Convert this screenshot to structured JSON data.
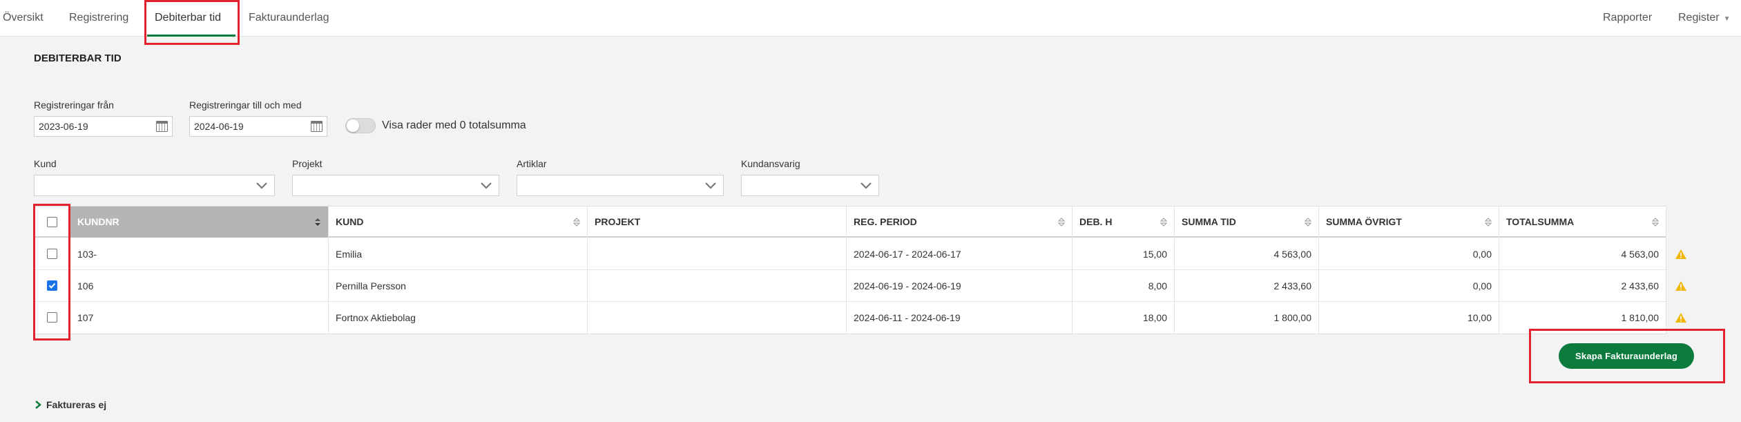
{
  "nav": {
    "tabs": [
      "Översikt",
      "Registrering",
      "Debiterbar tid",
      "Fakturaunderlag"
    ],
    "right": [
      "Rapporter",
      "Register"
    ]
  },
  "page_title": "DEBITERBAR TID",
  "filters": {
    "from_label": "Registreringar från",
    "from_value": "2023-06-19",
    "to_label": "Registreringar till och med",
    "to_value": "2024-06-19",
    "toggle_label": "Visa rader med 0 totalsumma",
    "toggle_on": false,
    "kund_label": "Kund",
    "projekt_label": "Projekt",
    "artiklar_label": "Artiklar",
    "kundansvarig_label": "Kundansvarig"
  },
  "table": {
    "columns": [
      "KUNDNR",
      "KUND",
      "PROJEKT",
      "REG. PERIOD",
      "DEB. H",
      "SUMMA TID",
      "SUMMA ÖVRIGT",
      "TOTALSUMMA"
    ],
    "rows": [
      {
        "kundnr": "103-",
        "kund": "Emilia",
        "projekt": "",
        "period": "2024-06-17 - 2024-06-17",
        "deb_h": "15,00",
        "summa_tid": "4 563,00",
        "summa_ovrigt": "0,00",
        "totalsumma": "4 563,00",
        "checked": false
      },
      {
        "kundnr": "106",
        "kund": "Pernilla Persson",
        "projekt": "",
        "period": "2024-06-19 - 2024-06-19",
        "deb_h": "8,00",
        "summa_tid": "2 433,60",
        "summa_ovrigt": "0,00",
        "totalsumma": "2 433,60",
        "checked": true
      },
      {
        "kundnr": "107",
        "kund": "Fortnox Aktiebolag",
        "projekt": "",
        "period": "2024-06-11 - 2024-06-19",
        "deb_h": "18,00",
        "summa_tid": "1 800,00",
        "summa_ovrigt": "10,00",
        "totalsumma": "1 810,00",
        "checked": false
      }
    ]
  },
  "actions": {
    "create_button": "Skapa Fakturaunderlag",
    "collapse_label": "Faktureras ej"
  },
  "colors": {
    "brand_green": "#0b7a3d",
    "highlight_red": "#e4212e",
    "warning_yellow": "#f2b705"
  }
}
